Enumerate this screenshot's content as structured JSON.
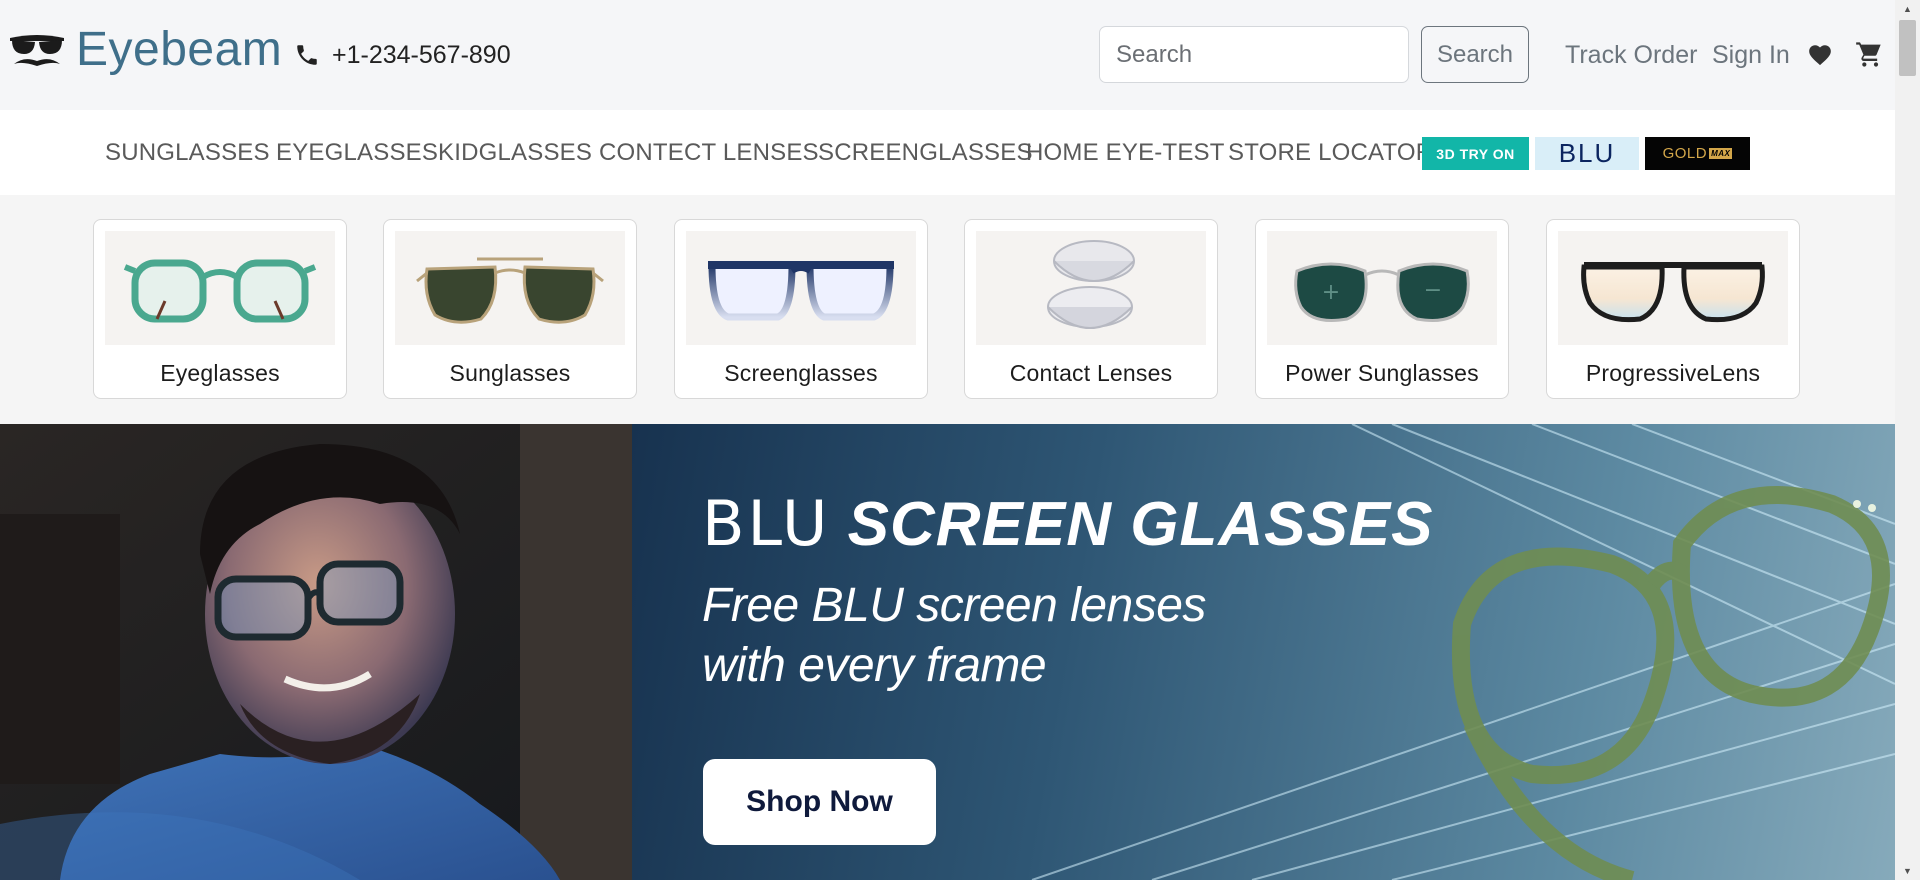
{
  "header": {
    "brand": "Eyebeam",
    "logo_icon": "mustache-sunglasses-icon",
    "phone": "+1-234-567-890",
    "phone_icon": "phone-icon",
    "search_placeholder": "Search",
    "search_button": "Search",
    "track_order": "Track Order",
    "sign_in": "Sign In",
    "wishlist_icon": "heart-icon",
    "cart_icon": "cart-icon",
    "brand_color": "#3f6f8a"
  },
  "nav": {
    "items": [
      "SUNGLASSES",
      "EYEGLASSES",
      "KIDGLASSES",
      "CONTECT LENSES",
      "SCREENGLASSES",
      "HOME EYE-TEST",
      "STORE LOCATOR"
    ],
    "badges": {
      "try_on": "3D TRY ON",
      "blu": "BLU",
      "gold": "GOLD",
      "gold_tag": "MAX"
    }
  },
  "categories": [
    {
      "label": "Eyeglasses",
      "image": "green-eyeglasses"
    },
    {
      "label": "Sunglasses",
      "image": "aviator-sunglasses"
    },
    {
      "label": "Screenglasses",
      "image": "blue-screenglasses"
    },
    {
      "label": "Contact Lenses",
      "image": "contact-lenses"
    },
    {
      "label": "Power Sunglasses",
      "image": "power-sunglasses"
    },
    {
      "label": "ProgressiveLens",
      "image": "progressive-lens-glasses"
    }
  ],
  "hero": {
    "title_brand": "BLU",
    "title_main": "SCREEN GLASSES",
    "subtitle_line1": "Free BLU screen lenses",
    "subtitle_line2": "with every frame",
    "cta": "Shop Now"
  }
}
